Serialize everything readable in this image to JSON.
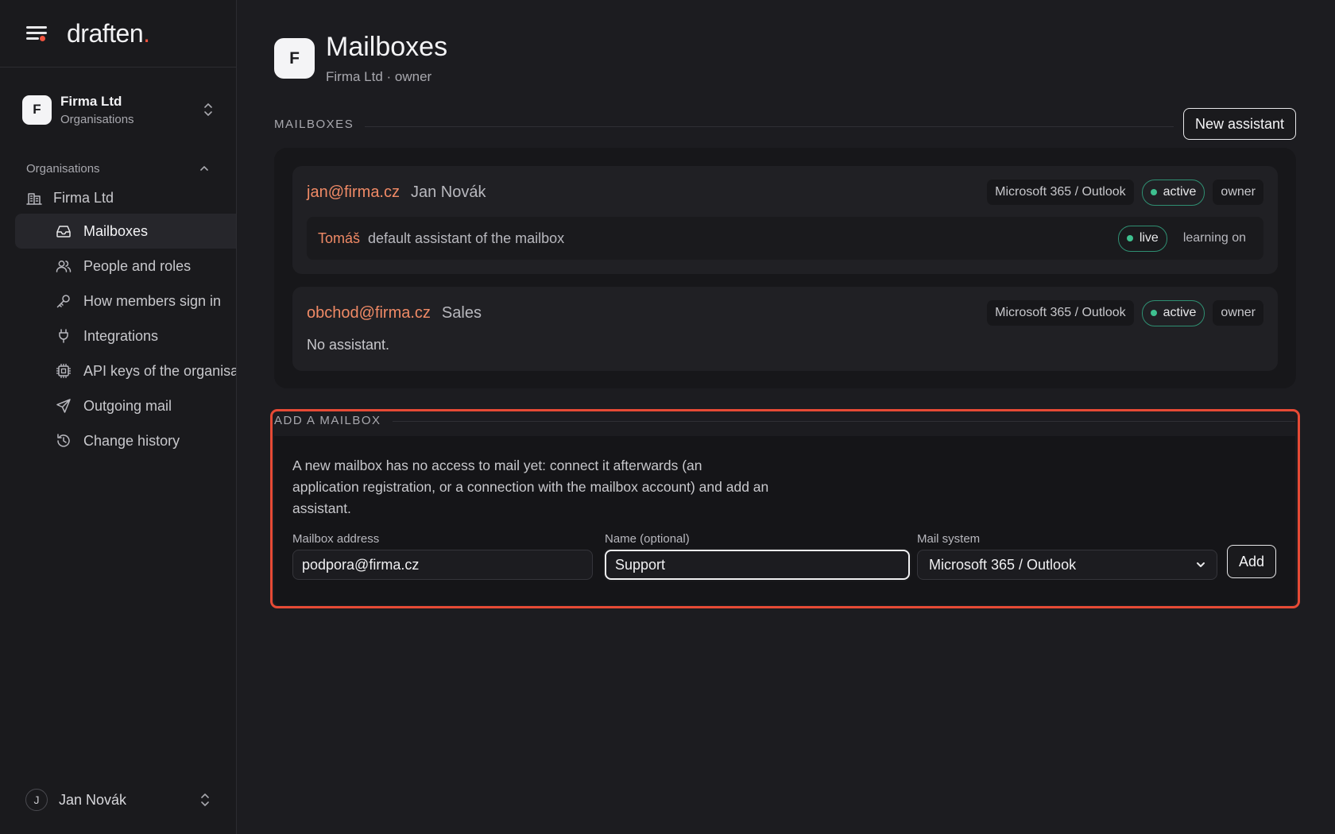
{
  "brand": {
    "logo_text": "draften",
    "logo_dot": ".",
    "accent": "#f0533e"
  },
  "sidebar": {
    "org_switcher": {
      "initial": "F",
      "name": "Firma Ltd",
      "sub": "Organisations"
    },
    "section_label": "Organisations",
    "org_item": "Firma Ltd",
    "items": [
      {
        "label": "Mailboxes",
        "icon": "inbox-icon",
        "active": true
      },
      {
        "label": "People and roles",
        "icon": "users-icon"
      },
      {
        "label": "How members sign in",
        "icon": "key-icon"
      },
      {
        "label": "Integrations",
        "icon": "plug-icon"
      },
      {
        "label": "API keys of the organisa",
        "icon": "cpu-icon"
      },
      {
        "label": "Outgoing mail",
        "icon": "send-icon"
      },
      {
        "label": "Change history",
        "icon": "history-icon"
      }
    ],
    "user": {
      "initial": "J",
      "name": "Jan Novák"
    }
  },
  "page": {
    "initial": "F",
    "title": "Mailboxes",
    "subtitle": "Firma Ltd · owner"
  },
  "mailboxes_section": {
    "label": "MAILBOXES",
    "new_button": "New assistant",
    "items": [
      {
        "email": "jan@firma.cz",
        "name": "Jan Novák",
        "system": "Microsoft 365 / Outlook",
        "status": "active",
        "role": "owner",
        "assistant": {
          "name": "Tomáš",
          "description": "default assistant of the mailbox",
          "status": "live",
          "learning": "learning on"
        }
      },
      {
        "email": "obchod@firma.cz",
        "name": "Sales",
        "system": "Microsoft 365 / Outlook",
        "status": "active",
        "role": "owner",
        "no_assistant": "No assistant."
      }
    ]
  },
  "add_mailbox": {
    "label": "ADD A MAILBOX",
    "description": "A new mailbox has no access to mail yet: connect it afterwards (an application registration, or a connection with the mailbox account) and add an assistant.",
    "address_label": "Mailbox address",
    "address_value": "podpora@firma.cz",
    "name_label": "Name (optional)",
    "name_value": "Support",
    "system_label": "Mail system",
    "system_value": "Microsoft 365 / Outlook",
    "add_button": "Add"
  }
}
